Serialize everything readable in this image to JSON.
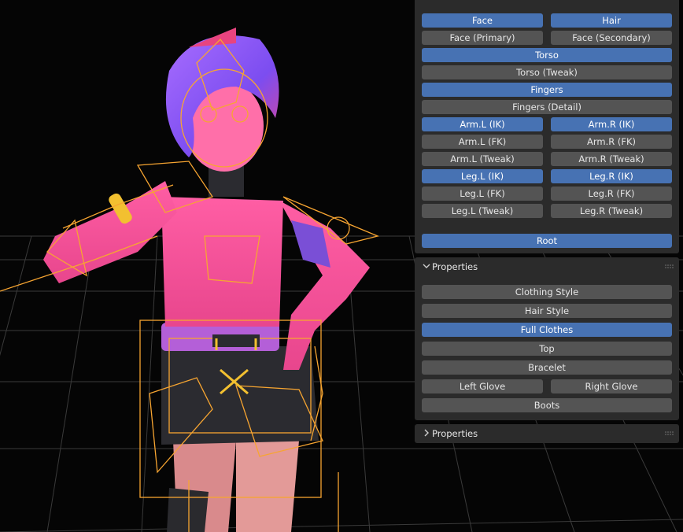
{
  "rig_layers": {
    "rows": [
      [
        "Face",
        "Hair"
      ],
      [
        "Face (Primary)",
        "Face (Secondary)"
      ],
      [
        "Torso"
      ],
      [
        "Torso (Tweak)"
      ],
      [
        "Fingers"
      ],
      [
        "Fingers (Detail)"
      ],
      [
        "Arm.L (IK)",
        "Arm.R (IK)"
      ],
      [
        "Arm.L (FK)",
        "Arm.R (FK)"
      ],
      [
        "Arm.L (Tweak)",
        "Arm.R (Tweak)"
      ],
      [
        "Leg.L (IK)",
        "Leg.R (IK)"
      ],
      [
        "Leg.L (FK)",
        "Leg.R (FK)"
      ],
      [
        "Leg.L (Tweak)",
        "Leg.R (Tweak)"
      ]
    ],
    "active": [
      [
        true,
        true
      ],
      [
        false,
        false
      ],
      [
        true
      ],
      [
        false
      ],
      [
        true
      ],
      [
        false
      ],
      [
        true,
        true
      ],
      [
        false,
        false
      ],
      [
        false,
        false
      ],
      [
        true,
        true
      ],
      [
        false,
        false
      ],
      [
        false,
        false
      ]
    ],
    "root_label": "Root"
  },
  "properties_panel": {
    "title": "Properties",
    "rows": [
      [
        "Clothing Style"
      ],
      [
        "Hair Style"
      ],
      [
        "Full Clothes"
      ],
      [
        "Top"
      ],
      [
        "Bracelet"
      ],
      [
        "Left Glove",
        "Right Glove"
      ],
      [
        "Boots"
      ]
    ],
    "active": [
      [
        false
      ],
      [
        false
      ],
      [
        true
      ],
      [
        false
      ],
      [
        false
      ],
      [
        false,
        false
      ],
      [
        false
      ]
    ]
  },
  "collapsed_panel": {
    "title": "Properties"
  },
  "colors": {
    "panel_bg": "#2b2b2b",
    "button": "#545454",
    "button_active": "#4772b3",
    "bone_wire": "#f7a531"
  }
}
